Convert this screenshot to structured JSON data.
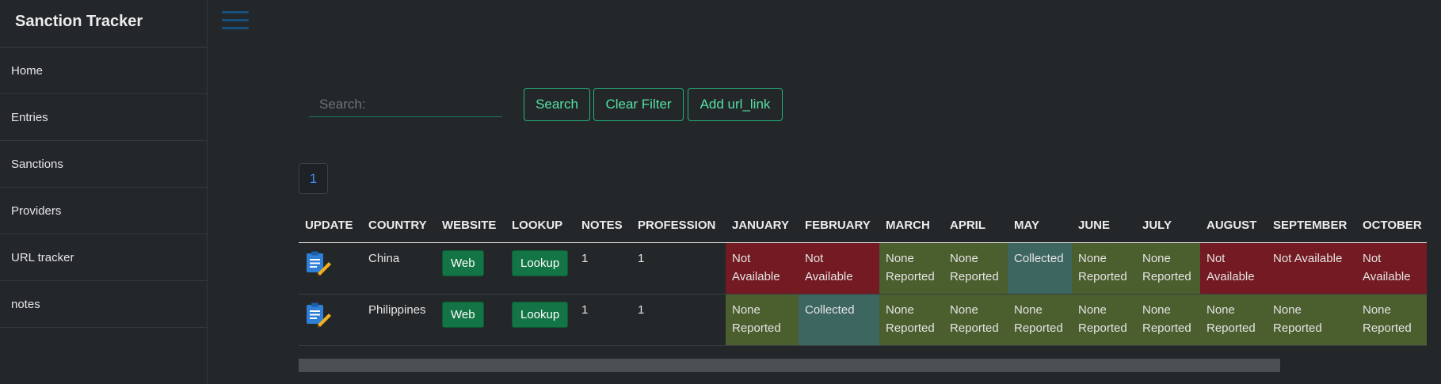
{
  "app": {
    "title": "Sanction Tracker"
  },
  "sidebar": {
    "items": [
      {
        "label": "Home"
      },
      {
        "label": "Entries"
      },
      {
        "label": "Sanctions"
      },
      {
        "label": "Providers"
      },
      {
        "label": "URL tracker"
      },
      {
        "label": "notes"
      }
    ]
  },
  "icons": {
    "menu": "hamburger-menu-icon",
    "update": "clipboard-edit-icon"
  },
  "search": {
    "placeholder": "Search:",
    "value": ""
  },
  "toolbar": {
    "search_label": "Search",
    "clear_label": "Clear Filter",
    "add_label": "Add url_link"
  },
  "pagination": {
    "current": "1"
  },
  "table": {
    "headers": [
      "UPDATE",
      "COUNTRY",
      "WEBSITE",
      "LOOKUP",
      "NOTES",
      "PROFESSION",
      "JANUARY",
      "FEBRUARY",
      "MARCH",
      "APRIL",
      "MAY",
      "JUNE",
      "JULY",
      "AUGUST",
      "SEPTEMBER",
      "OCTOBER"
    ],
    "rows": [
      {
        "country": "China",
        "website": "Web",
        "lookup": "Lookup",
        "notes": "1",
        "profession": "1",
        "months": [
          "Not Available",
          "Not Available",
          "None Reported",
          "None Reported",
          "Collected",
          "None Reported",
          "None Reported",
          "Not Available",
          "Not Available",
          "Not Available"
        ]
      },
      {
        "country": "Philippines",
        "website": "Web",
        "lookup": "Lookup",
        "notes": "1",
        "profession": "1",
        "months": [
          "None Reported",
          "Collected",
          "None Reported",
          "None Reported",
          "None Reported",
          "None Reported",
          "None Reported",
          "None Reported",
          "None Reported",
          "None Reported"
        ]
      }
    ]
  },
  "colors": {
    "not_available": "#741a22",
    "none_reported": "#4b5e2e",
    "collected": "#3e6661",
    "accent": "#23b37b",
    "link": "#3d8cf0"
  }
}
